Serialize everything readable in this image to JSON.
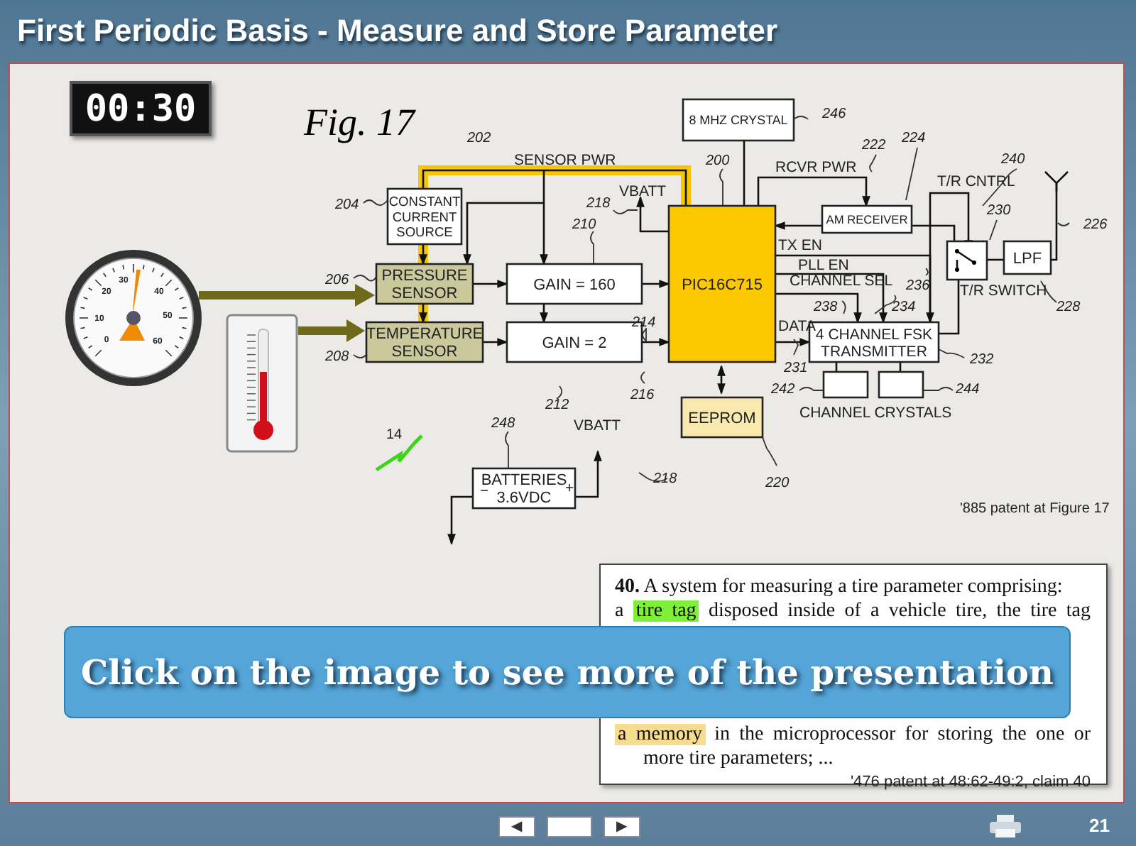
{
  "title": "First Periodic Basis - Measure and Store Parameter",
  "timer": "00:30",
  "figure": {
    "caption": "Fig. 17",
    "gauge_scale": [
      "0",
      "10",
      "20",
      "30",
      "40",
      "50",
      "60"
    ],
    "blocks": [
      {
        "kind": "plain",
        "lines": [
          "CONSTANT",
          "CURRENT",
          "SOURCE"
        ]
      },
      {
        "kind": "sensor",
        "lines": [
          "PRESSURE",
          "SENSOR"
        ]
      },
      {
        "kind": "sensor",
        "lines": [
          "TEMPERATURE",
          "SENSOR"
        ]
      },
      {
        "kind": "plain",
        "lines": [
          "GAIN = 160"
        ]
      },
      {
        "kind": "plain",
        "lines": [
          "GAIN = 2"
        ]
      },
      {
        "kind": "plain",
        "lines": [
          "8 MHZ CRYSTAL"
        ]
      },
      {
        "kind": "processor",
        "lines": [
          "PIC16C715"
        ]
      },
      {
        "kind": "plain",
        "lines": [
          "AM RECEIVER"
        ]
      },
      {
        "kind": "plain",
        "lines": [
          "LPF"
        ]
      },
      {
        "kind": "plain",
        "lines": [
          "4 CHANNEL FSK",
          "TRANSMITTER"
        ]
      },
      {
        "kind": "memory",
        "lines": [
          "EEPROM"
        ]
      },
      {
        "kind": "plain",
        "lines": [
          "BATTERIES",
          "3.6VDC"
        ]
      }
    ],
    "signal_labels": [
      "SENSOR PWR",
      "VBATT",
      "VBATT",
      "RCVR PWR",
      "T/R CNTRL",
      "TX EN",
      "PLL EN",
      "CHANNEL SEL",
      "DATA",
      "T/R SWITCH",
      "CHANNEL CRYSTALS",
      "−",
      "+"
    ],
    "reference_numbers": [
      "202",
      "204",
      "206",
      "208",
      "210",
      "212",
      "214",
      "216",
      "218",
      "218",
      "248",
      "200",
      "246",
      "222",
      "224",
      "240",
      "230",
      "226",
      "228",
      "236",
      "238",
      "234",
      "231",
      "232",
      "242",
      "244",
      "220",
      "14"
    ],
    "source": "'885 patent at Figure 17"
  },
  "claim": {
    "paragraphs": [
      {
        "kind": "item",
        "segments": [
          {
            "text": "**40.** A system for measuring a tire parameter comprising:"
          }
        ]
      },
      {
        "kind": "cut",
        "segments": [
          {
            "text": "a "
          },
          {
            "text": "tire tag",
            "color": "#7ef03a"
          },
          {
            "text": " disposed inside of a vehicle tire, the tire tag"
          }
        ]
      },
      {
        "kind": "after_gap",
        "segments": [
          {
            "text": "a memory",
            "color": "#f6dc8e"
          },
          {
            "text": " in the microprocessor for storing the one or more tire parameters; ..."
          }
        ]
      }
    ],
    "source": "'476 patent at 48:62-49:2, claim 40"
  },
  "overlay": "Click on the image to see more of the presentation",
  "footer": {
    "prev": "◀",
    "next": "▶",
    "page": "21"
  }
}
